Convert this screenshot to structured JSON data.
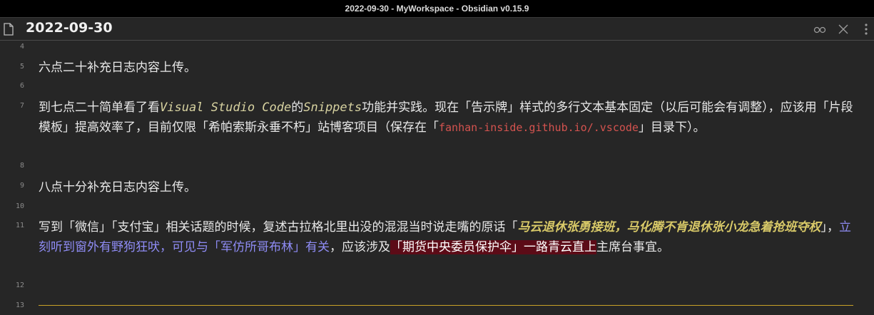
{
  "window": {
    "title": "2022-09-30 - MyWorkspace - Obsidian v0.15.9"
  },
  "header": {
    "note_title": "2022-09-30",
    "actions": [
      "reading-view-icon",
      "close-icon",
      "more-options-icon"
    ]
  },
  "editor": {
    "line_numbers": [
      "4",
      "5",
      "6",
      "7",
      "8",
      "9",
      "10",
      "11",
      "12",
      "13"
    ],
    "line5": "六点二十补充日志内容上传。",
    "line7": {
      "p1": "到七点二十简单看了看",
      "i1": "Visual Studio Code",
      "p2": "的",
      "i2": "Snippets",
      "p3": "功能并实践。现在「告示牌」样式的多行文本基本固定（以后可能会有调整），应该用「片段模板」提高效率了，目前仅限「希帕索斯永垂不朽」站博客项目（保存在「",
      "code": "fanhan-inside.github.io/.vscode",
      "p4": "」目录下）。"
    },
    "line9": "八点十分补充日志内容上传。",
    "line11": {
      "p1": "写到「微信」「支付宝」相关话题的时候，复述古拉格北里出没的混混当时说走嘴的原话「",
      "italic": "马云退休张勇接班，马化腾不肯退休张小龙急着抢班夺权",
      "p2": "」，",
      "purple": "立刻听到窗外有野狗狂吠，可见与「军仿所哥布林」有关",
      "p3": "，应该涉及",
      "mark": "「期货中央委员保护伞」一路青云直上",
      "p4": "主席台事宜。"
    }
  }
}
